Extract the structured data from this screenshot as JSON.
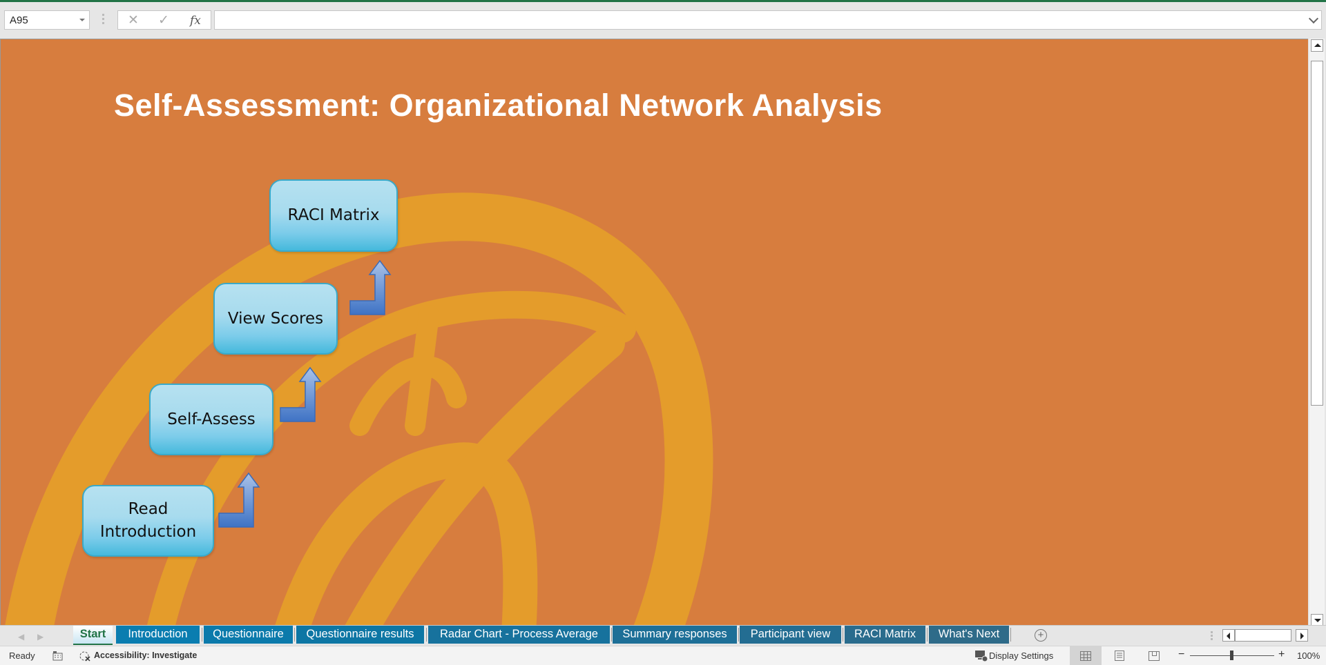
{
  "formula_bar": {
    "name_box": "A95",
    "cancel_icon": "✕",
    "enter_icon": "✓",
    "fx_label": "fx",
    "formula_value": ""
  },
  "sheet": {
    "background_color": "#d77d3e",
    "swirl_color": "#e49c2b",
    "title": "Self-Assessment: Organizational Network Analysis",
    "flow_boxes": [
      {
        "label": "Read\nIntroduction",
        "line1": "Read",
        "line2": "Introduction"
      },
      {
        "label": "Self-Assess"
      },
      {
        "label": "View Scores"
      },
      {
        "label": "RACI Matrix"
      }
    ],
    "flow_arrow_color": "#4a7fcc"
  },
  "tabs": {
    "items": [
      {
        "label": "Start",
        "active": true
      },
      {
        "label": "Introduction"
      },
      {
        "label": "Questionnaire"
      },
      {
        "label": "Questionnaire results"
      },
      {
        "label": "Radar Chart - Process Average"
      },
      {
        "label": "Summary responses"
      },
      {
        "label": "Participant view"
      },
      {
        "label": "RACI Matrix"
      },
      {
        "label": "What's Next"
      }
    ],
    "add_sheet_icon": "+"
  },
  "status_bar": {
    "ready": "Ready",
    "accessibility": "Accessibility: Investigate",
    "display_settings": "Display Settings",
    "zoom_minus": "−",
    "zoom_plus": "+",
    "zoom_level": "100%"
  }
}
